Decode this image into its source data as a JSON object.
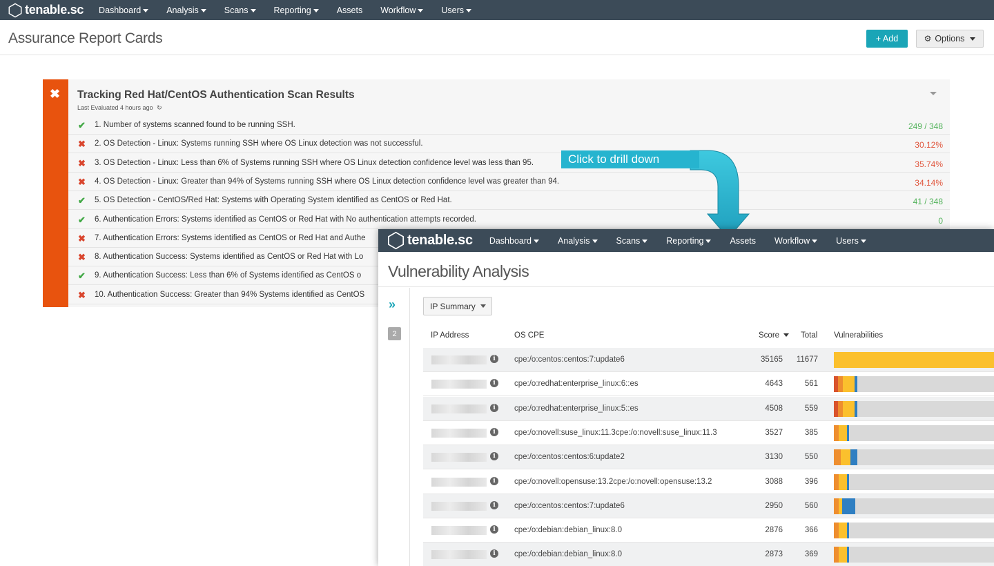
{
  "nav": {
    "logo": "tenable.sc",
    "items": [
      "Dashboard",
      "Analysis",
      "Scans",
      "Reporting",
      "Assets",
      "Workflow",
      "Users"
    ],
    "has_caret": [
      true,
      true,
      true,
      true,
      false,
      true,
      true
    ]
  },
  "header": {
    "title": "Assurance Report Cards",
    "add_label": "+ Add",
    "options_label": "Options"
  },
  "card": {
    "title": "Tracking Red Hat/CentOS Authentication Scan Results",
    "last_evaluated": "Last Evaluated 4 hours ago",
    "colors": {
      "stripe": "#e8530e",
      "pass": "#41a845",
      "fail": "#d9452d"
    },
    "rows": [
      {
        "status": "pass",
        "text": "1. Number of systems scanned found to be running SSH.",
        "value": "249 / 348"
      },
      {
        "status": "fail",
        "text": "2. OS Detection - Linux: Systems running SSH where OS Linux detection was not successful.",
        "value": "30.12%"
      },
      {
        "status": "fail",
        "text": "3. OS Detection - Linux: Less than 6% of Systems running SSH where OS Linux detection confidence level was less than 95.",
        "value": "35.74%"
      },
      {
        "status": "fail",
        "text": "4. OS Detection - Linux: Greater than 94% of Systems running SSH where OS Linux detection confidence level was greater than 94.",
        "value": "34.14%"
      },
      {
        "status": "pass",
        "text": "5. OS Detection - CentOS/Red Hat: Systems with Operating System identified as CentOS or Red Hat.",
        "value": "41 / 348"
      },
      {
        "status": "pass",
        "text": "6. Authentication Errors: Systems identified as CentOS or Red Hat with No authentication attempts recorded.",
        "value": "0"
      },
      {
        "status": "fail",
        "text": "7. Authentication Errors: Systems identified as CentOS or Red Hat and Authe",
        "value": ""
      },
      {
        "status": "fail",
        "text": "8. Authentication Success: Systems identified as CentOS or Red Hat with Lo",
        "value": ""
      },
      {
        "status": "pass",
        "text": "9. Authentication Success: Less than 6% of Systems identified as CentOS o",
        "value": ""
      },
      {
        "status": "fail",
        "text": "10. Authentication Success: Greater than 94% Systems identified as CentOS",
        "value": ""
      }
    ]
  },
  "callout": {
    "text": "Click to drill down",
    "color": "#26b4cf"
  },
  "overlay": {
    "title": "Vulnerability Analysis",
    "tool": "IP Summary",
    "badge": "2",
    "columns": {
      "ip": "IP Address",
      "os": "OS CPE",
      "score": "Score",
      "total": "Total",
      "vulns": "Vulnerabilities"
    },
    "severity_colors": {
      "critical": "#d9532c",
      "high": "#ee8e2f",
      "medium": "#fbc02d",
      "low": "#2f7fc2",
      "info": "#d9d9d9"
    },
    "rows": [
      {
        "os_cpe": "cpe:/o:centos:centos:7:update6",
        "score": "35165",
        "total": "11677",
        "bars": {
          "critical": 0.0,
          "high": 0.0,
          "medium": 1.0,
          "low": 0.0
        }
      },
      {
        "os_cpe": "cpe:/o:redhat:enterprise_linux:6::es",
        "score": "4643",
        "total": "561",
        "bars": {
          "critical": 0.025,
          "high": 0.03,
          "medium": 0.07,
          "low": 0.015
        }
      },
      {
        "os_cpe": "cpe:/o:redhat:enterprise_linux:5::es",
        "score": "4508",
        "total": "559",
        "bars": {
          "critical": 0.025,
          "high": 0.03,
          "medium": 0.07,
          "low": 0.015
        }
      },
      {
        "os_cpe": "cpe:/o:novell:suse_linux:11.3cpe:/o:novell:suse_linux:11.3",
        "score": "3527",
        "total": "385",
        "bars": {
          "critical": 0.0,
          "high": 0.03,
          "medium": 0.05,
          "low": 0.01
        }
      },
      {
        "os_cpe": "cpe:/o:centos:centos:6:update2",
        "score": "3130",
        "total": "550",
        "bars": {
          "critical": 0.0,
          "high": 0.04,
          "medium": 0.06,
          "low": 0.04
        }
      },
      {
        "os_cpe": "cpe:/o:novell:opensuse:13.2cpe:/o:novell:opensuse:13.2",
        "score": "3088",
        "total": "396",
        "bars": {
          "critical": 0.0,
          "high": 0.03,
          "medium": 0.05,
          "low": 0.01
        }
      },
      {
        "os_cpe": "cpe:/o:centos:centos:7:update6",
        "score": "2950",
        "total": "560",
        "bars": {
          "critical": 0.0,
          "high": 0.03,
          "medium": 0.02,
          "low": 0.08
        }
      },
      {
        "os_cpe": "cpe:/o:debian:debian_linux:8.0",
        "score": "2876",
        "total": "366",
        "bars": {
          "critical": 0.0,
          "high": 0.03,
          "medium": 0.05,
          "low": 0.01
        }
      },
      {
        "os_cpe": "cpe:/o:debian:debian_linux:8.0",
        "score": "2873",
        "total": "369",
        "bars": {
          "critical": 0.0,
          "high": 0.03,
          "medium": 0.05,
          "low": 0.01
        }
      }
    ]
  }
}
